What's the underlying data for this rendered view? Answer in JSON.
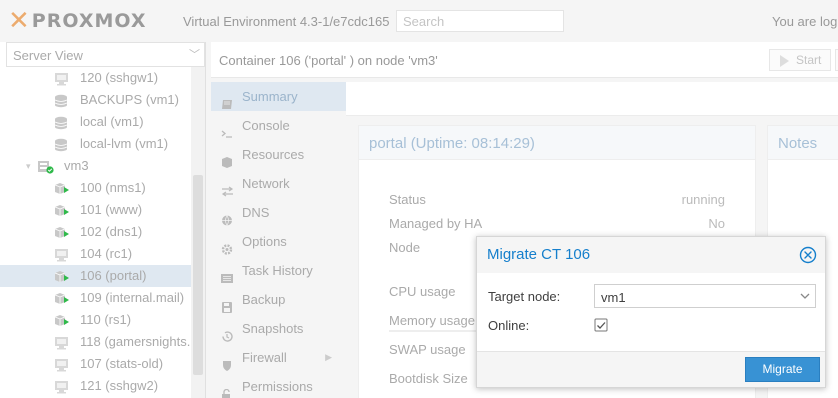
{
  "header": {
    "logo_text": "PROXMOX",
    "version": "Virtual Environment 4.3-1/e7cdc165",
    "search_placeholder": "Search",
    "logged_in_text": "You are log"
  },
  "tree": {
    "view_label": "Server View",
    "items": [
      {
        "label": "120 (sshgw1)",
        "icon": "container-stopped-icon",
        "indent": 54
      },
      {
        "label": "BACKUPS (vm1)",
        "icon": "storage-icon",
        "indent": 54
      },
      {
        "label": "local (vm1)",
        "icon": "storage-icon",
        "indent": 54
      },
      {
        "label": "local-lvm (vm1)",
        "icon": "storage-icon",
        "indent": 54
      },
      {
        "label": "vm3",
        "icon": "node-online-icon",
        "indent": 38
      },
      {
        "label": "100 (nms1)",
        "icon": "container-running-icon",
        "indent": 54
      },
      {
        "label": "101 (www)",
        "icon": "container-running-icon",
        "indent": 54
      },
      {
        "label": "102 (dns1)",
        "icon": "container-running-icon",
        "indent": 54
      },
      {
        "label": "104 (rc1)",
        "icon": "container-stopped-icon",
        "indent": 54
      },
      {
        "label": "106 (portal)",
        "icon": "container-running-icon",
        "indent": 54,
        "selected": true
      },
      {
        "label": "109 (internal.mail)",
        "icon": "container-running-icon",
        "indent": 54
      },
      {
        "label": "110 (rs1)",
        "icon": "container-running-icon",
        "indent": 54
      },
      {
        "label": "118 (gamersnights.",
        "icon": "container-stopped-icon",
        "indent": 54
      },
      {
        "label": "107 (stats-old)",
        "icon": "container-stopped-icon",
        "indent": 54
      },
      {
        "label": "121 (sshgw2)",
        "icon": "container-stopped-icon",
        "indent": 54
      }
    ]
  },
  "content": {
    "title": "Container 106 ('portal' ) on node 'vm3'",
    "start_label": "Start"
  },
  "nav": {
    "items": [
      {
        "label": "Summary",
        "icon": "book-icon",
        "active": true
      },
      {
        "label": "Console",
        "icon": "terminal-icon"
      },
      {
        "label": "Resources",
        "icon": "cube-icon"
      },
      {
        "label": "Network",
        "icon": "exchange-icon"
      },
      {
        "label": "DNS",
        "icon": "globe-icon"
      },
      {
        "label": "Options",
        "icon": "gear-icon"
      },
      {
        "label": "Task History",
        "icon": "list-icon"
      },
      {
        "label": "Backup",
        "icon": "floppy-icon"
      },
      {
        "label": "Snapshots",
        "icon": "history-icon"
      },
      {
        "label": "Firewall",
        "icon": "shield-icon",
        "submenu": true
      },
      {
        "label": "Permissions",
        "icon": "unlock-icon"
      }
    ]
  },
  "status_panel": {
    "title": "portal (Uptime: 08:14:29)",
    "rows": [
      {
        "key": "Status",
        "value": "running"
      },
      {
        "key": "Managed by HA",
        "value": "No"
      },
      {
        "key": "Node",
        "value": ""
      },
      {
        "key": "CPU usage",
        "value": ""
      },
      {
        "key": "Memory usage",
        "value": ""
      },
      {
        "key": "SWAP usage",
        "value": ""
      },
      {
        "key": "Bootdisk Size",
        "value": ""
      }
    ]
  },
  "notes_panel": {
    "title": "Notes"
  },
  "modal": {
    "title": "Migrate CT 106",
    "target_label": "Target node:",
    "target_value": "vm1",
    "online_label": "Online:",
    "online_checked": true,
    "migrate_label": "Migrate"
  },
  "colors": {
    "accent": "#157fcc",
    "button": "#3892d4",
    "logo_orange": "#e57000",
    "running_green": "#2fb94a"
  }
}
